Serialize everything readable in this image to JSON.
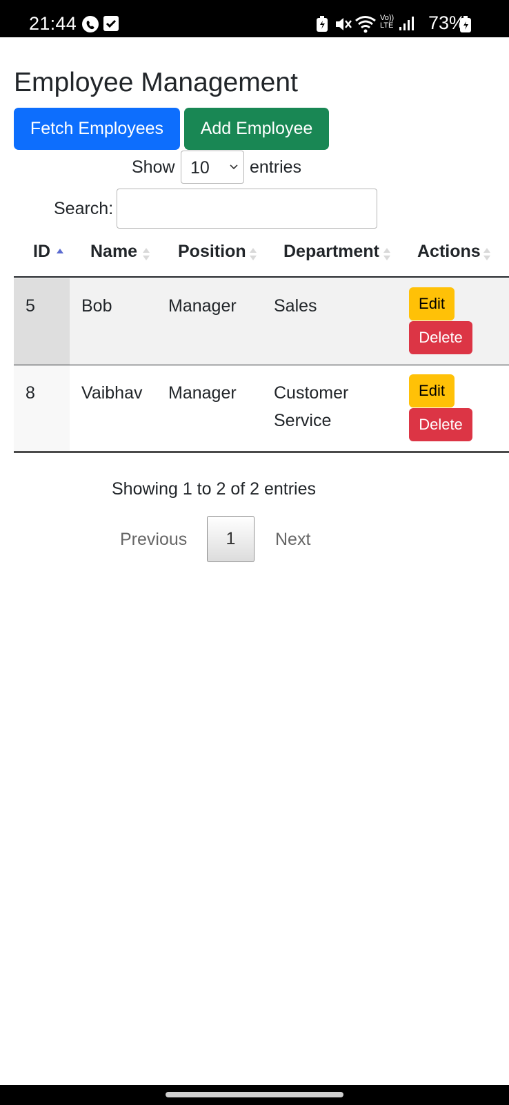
{
  "status_bar": {
    "time": "21:44",
    "battery_percent": "73%",
    "network_label": "Vo)) LTE",
    "icons": [
      "phone-call-icon",
      "checkbox-notification-icon",
      "battery-saver-icon",
      "mute-icon",
      "wifi-icon",
      "signal-icon",
      "battery-charging-icon"
    ]
  },
  "page": {
    "title": "Employee Management",
    "buttons": {
      "fetch": "Fetch Employees",
      "add": "Add Employee"
    },
    "length": {
      "label_before": "Show",
      "selected": "10",
      "label_after": "entries"
    },
    "search": {
      "label": "Search:",
      "value": "",
      "placeholder": ""
    },
    "table": {
      "columns": [
        "ID",
        "Name",
        "Position",
        "Department",
        "Actions"
      ],
      "sorted_column": "ID",
      "rows": [
        {
          "id": "5",
          "name": "Bob",
          "position": "Manager",
          "department": "Sales",
          "edit": "Edit",
          "delete": "Delete"
        },
        {
          "id": "8",
          "name": "Vaibhav",
          "position": "Manager",
          "department": "Customer Service",
          "edit": "Edit",
          "delete": "Delete"
        }
      ]
    },
    "info": "Showing 1 to 2 of 2 entries",
    "pagination": {
      "previous": "Previous",
      "current": "1",
      "next": "Next"
    }
  },
  "colors": {
    "primary": "#0d6efd",
    "success": "#198754",
    "warning": "#ffc107",
    "danger": "#dc3545",
    "sort_active": "#5b6bd0"
  }
}
